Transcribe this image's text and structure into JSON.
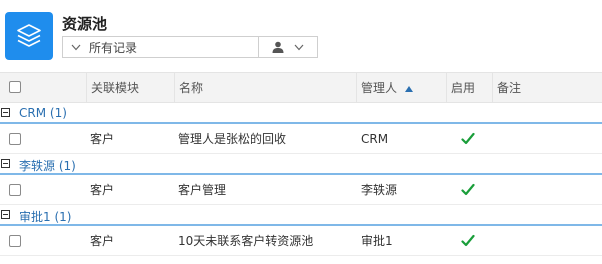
{
  "app": {
    "title": "资源池",
    "icon": "layers-icon"
  },
  "filter": {
    "selected": "所有记录",
    "icon": "chevron-down-icon"
  },
  "owner_filter": {
    "icon": "user-icon",
    "chevron": "chevron-down-icon"
  },
  "columns": {
    "module": "关联模块",
    "name": "名称",
    "manager": "管理人",
    "enabled": "启用",
    "notes": "备注",
    "sort_icon": "sort-asc-icon"
  },
  "groups": [
    {
      "title": "CRM (1)",
      "rows": [
        {
          "module": "客户",
          "name": "管理人是张松的回收",
          "manager": "CRM",
          "enabled": true
        }
      ]
    },
    {
      "title": "李轶源 (1)",
      "rows": [
        {
          "module": "客户",
          "name": "客户管理",
          "manager": "李轶源",
          "enabled": true
        }
      ]
    },
    {
      "title": "审批1 (1)",
      "rows": [
        {
          "module": "客户",
          "name": "10天未联系客户转资源池",
          "manager": "审批1",
          "enabled": true
        }
      ]
    }
  ],
  "colors": {
    "accent": "#1f8ded",
    "group_border": "#7fb8e8",
    "check": "#1a9e3a"
  }
}
